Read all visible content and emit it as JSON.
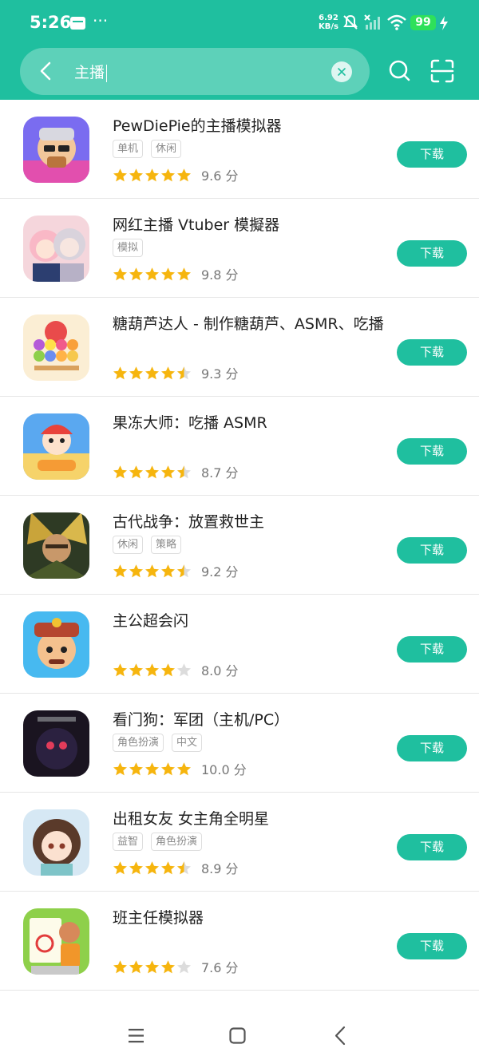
{
  "status_bar": {
    "time": "5:26",
    "net_speed_value": "6.92",
    "net_speed_unit": "KB/s",
    "battery": "99"
  },
  "search": {
    "query": "主播"
  },
  "results": [
    {
      "title": "PewDiePie的主播模拟器",
      "tags": [
        "单机",
        "休闲"
      ],
      "stars": 5,
      "score": "9.6 分",
      "download": "下载"
    },
    {
      "title": "网红主播 Vtuber 模擬器",
      "tags": [
        "模拟"
      ],
      "stars": 5,
      "score": "9.8 分",
      "download": "下载"
    },
    {
      "title": "糖葫芦达人 - 制作糖葫芦、ASMR、吃播",
      "tags": [],
      "stars": 4.5,
      "score": "9.3 分",
      "download": "下载"
    },
    {
      "title": "果冻大师：吃播 ASMR",
      "tags": [],
      "stars": 4.5,
      "score": "8.7 分",
      "download": "下载"
    },
    {
      "title": "古代战争：放置救世主",
      "tags": [
        "休闲",
        "策略"
      ],
      "stars": 4.5,
      "score": "9.2 分",
      "download": "下载"
    },
    {
      "title": "主公超会闪",
      "tags": [],
      "stars": 4,
      "score": "8.0 分",
      "download": "下载"
    },
    {
      "title": "看门狗：军团（主机/PC）",
      "tags": [
        "角色扮演",
        "中文"
      ],
      "stars": 5,
      "score": "10.0 分",
      "download": "下载"
    },
    {
      "title": "出租女友 女主角全明星",
      "tags": [
        "益智",
        "角色扮演"
      ],
      "stars": 4.5,
      "score": "8.9 分",
      "download": "下载"
    },
    {
      "title": "班主任模拟器",
      "tags": [],
      "stars": 4,
      "score": "7.6 分",
      "download": "下载"
    }
  ],
  "colors": {
    "accent": "#1fbf9f",
    "star": "#f6b50e",
    "star_empty": "#dcdcdc"
  },
  "icons": [
    "pewdiepie-app-icon",
    "vtuber-app-icon",
    "candy-skewer-app-icon",
    "jelly-asmr-app-icon",
    "ancient-war-app-icon",
    "warlord-app-icon",
    "watchdogs-app-icon",
    "rent-a-girlfriend-app-icon",
    "teacher-sim-app-icon"
  ]
}
